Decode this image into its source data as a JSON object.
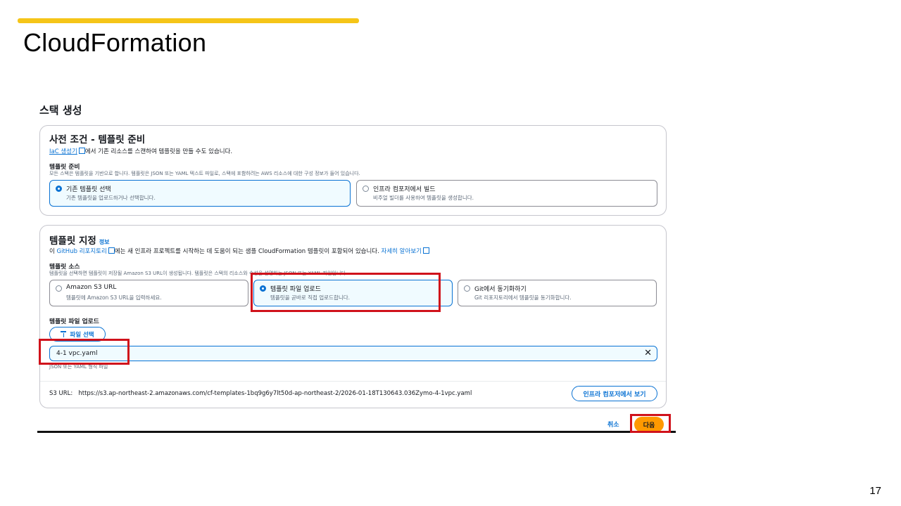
{
  "slide": {
    "title": "CloudFormation",
    "page_number": "17"
  },
  "page": {
    "heading": "스택 생성"
  },
  "prereq": {
    "title": "사전 조건 - 템플릿 준비",
    "iac_link": "IaC 생성기",
    "iac_text": "에서 기존 리소스를 스캔하여 템플릿을 만들 수도 있습니다.",
    "field_label": "템플릿 준비",
    "field_help": "모든 스택은 템플릿을 기반으로 합니다. 템플릿은 JSON 또는 YAML 텍스트 파일로, 스택에 포함하려는 AWS 리소스에 대한 구성 정보가 들어 있습니다.",
    "options": [
      {
        "label": "기존 템플릿 선택",
        "desc": "기존 템플릿을 업로드하거나 선택합니다.",
        "selected": true
      },
      {
        "label": "인프라 컴포저에서 빌드",
        "desc": "비주얼 빌더를 사용하여 템플릿을 생성합니다.",
        "selected": false
      }
    ]
  },
  "template": {
    "title": "템플릿 지정",
    "info": "정보",
    "desc_prefix": "이 ",
    "github_link": "GitHub 리포지토리",
    "desc_middle": "에는 새 인프라 프로젝트를 시작하는 데 도움이 되는 샘플 CloudFormation 템플릿이 포함되어 있습니다. ",
    "learn_more": "자세히 알아보기",
    "source_label": "템플릿 소스",
    "source_help": "템플릿을 선택하면 템플릿이 저장될 Amazon S3 URL이 생성됩니다. 템플릿은 스택의 리소스와 속성을 설명하는 JSON 또는 YAML 파일입니다.",
    "sources": [
      {
        "label": "Amazon S3 URL",
        "desc": "템플릿에 Amazon S3 URL을 입력하세요.",
        "selected": false
      },
      {
        "label": "템플릿 파일 업로드",
        "desc": "템플릿을 곧바로 직접 업로드합니다.",
        "selected": true
      },
      {
        "label": "Git에서 동기화하기",
        "desc": "Git 리포지토리에서 템플릿을 동기화합니다.",
        "selected": false
      }
    ],
    "upload_label": "템플릿 파일 업로드",
    "choose_file": "파일 선택",
    "file_name": "4-1 vpc.yaml",
    "file_hint": "JSON 또는 YAML 형식 파일",
    "s3_label": "S3 URL:",
    "s3_url": "https://s3.ap-northeast-2.amazonaws.com/cf-templates-1bq9g6y7lt50d-ap-northeast-2/2026-01-18T130643.036Zymo-4-1vpc.yaml",
    "view_button": "인프라 컴포저에서 보기"
  },
  "footer": {
    "cancel": "취소",
    "next": "다음"
  },
  "colors": {
    "accent_bar": "#f5c518",
    "link": "#0972d3",
    "primary_button": "#ff9900",
    "highlight_box": "#d0121b"
  }
}
